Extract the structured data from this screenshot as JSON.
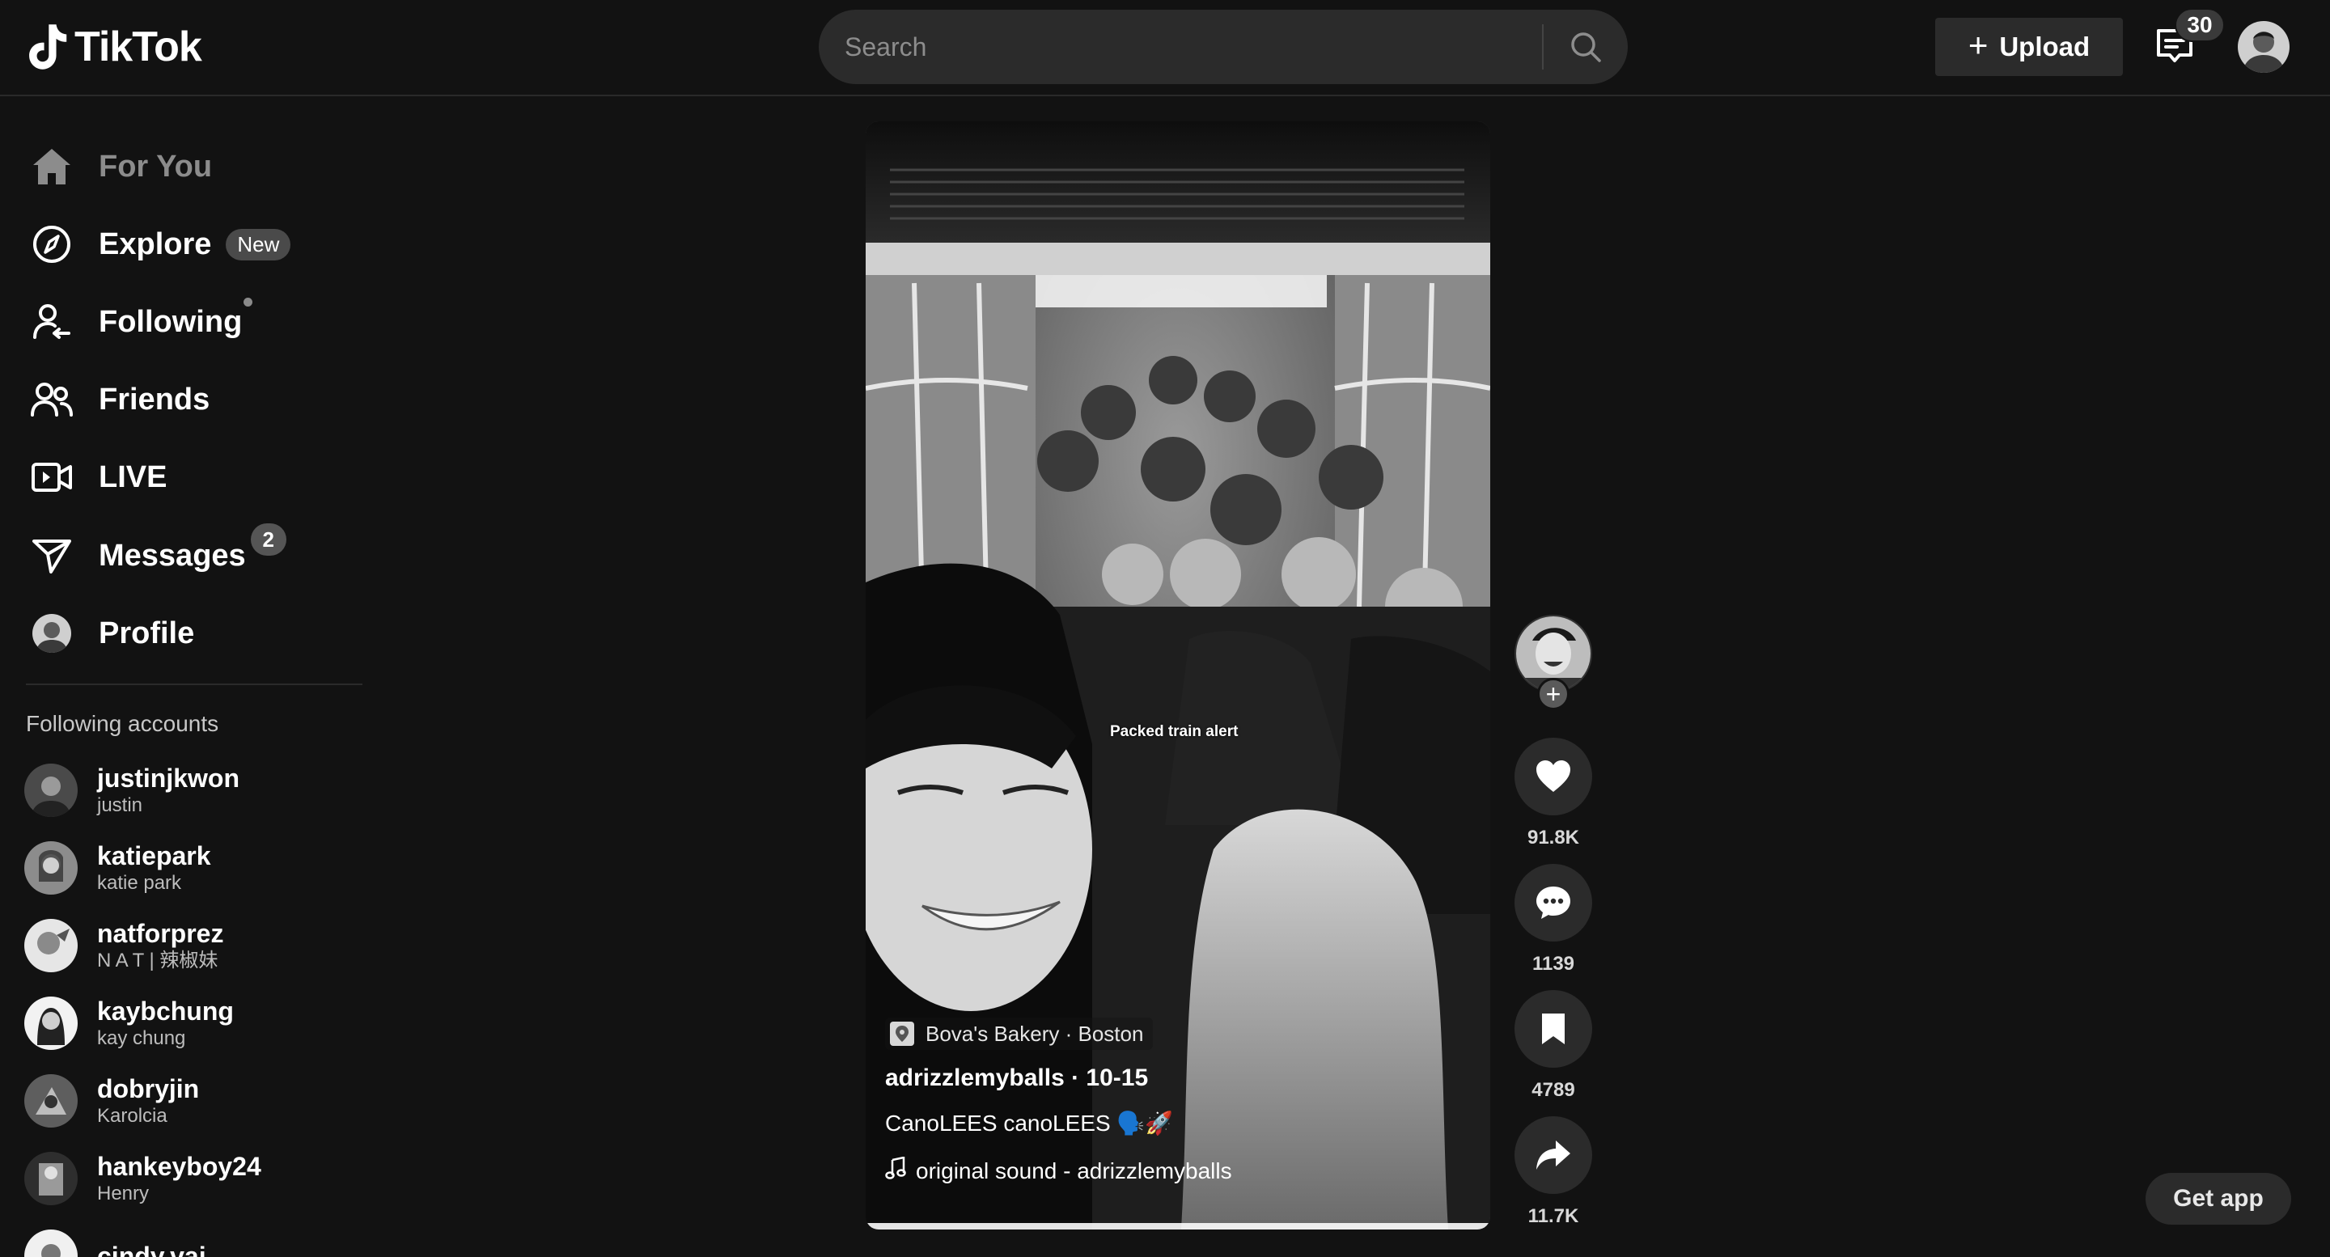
{
  "header": {
    "logo_text": "TikTok",
    "search_placeholder": "Search",
    "upload_label": "Upload",
    "inbox_count": "30"
  },
  "sidebar": {
    "nav": [
      {
        "label": "For You",
        "icon": "home-icon"
      },
      {
        "label": "Explore",
        "icon": "compass-icon",
        "badge": "New"
      },
      {
        "label": "Following",
        "icon": "following-icon"
      },
      {
        "label": "Friends",
        "icon": "friends-icon"
      },
      {
        "label": "LIVE",
        "icon": "live-icon"
      },
      {
        "label": "Messages",
        "icon": "messages-icon",
        "badge": "2"
      },
      {
        "label": "Profile",
        "icon": "profile-avatar"
      }
    ],
    "following_heading": "Following accounts",
    "accounts": [
      {
        "username": "justinjkwon",
        "display": "justin"
      },
      {
        "username": "katiepark",
        "display": "katie park"
      },
      {
        "username": "natforprez",
        "display": "N A T | 辣椒妹"
      },
      {
        "username": "kaybchung",
        "display": "kay chung"
      },
      {
        "username": "dobryjin",
        "display": "Karolcia"
      },
      {
        "username": "hankeyboy24",
        "display": "Henry"
      },
      {
        "username": "cindy.vaj",
        "display": ""
      }
    ]
  },
  "video": {
    "overlay_caption": "Packed train alert",
    "location": "Bova's Bakery · Boston",
    "author_line": "adrizzlemyballs · 10-15",
    "description": "CanoLEES canoLEES 🗣️🚀",
    "sound": "original sound - adrizzlemyballs",
    "progress_fraction": 1.0
  },
  "actions": {
    "likes": "91.8K",
    "comments": "1139",
    "saves": "4789",
    "shares": "11.7K"
  },
  "get_app_label": "Get app",
  "colors": {
    "background": "#121212",
    "surface": "#2b2b2b",
    "text": "#ffffff",
    "muted": "#8c8c8c"
  }
}
